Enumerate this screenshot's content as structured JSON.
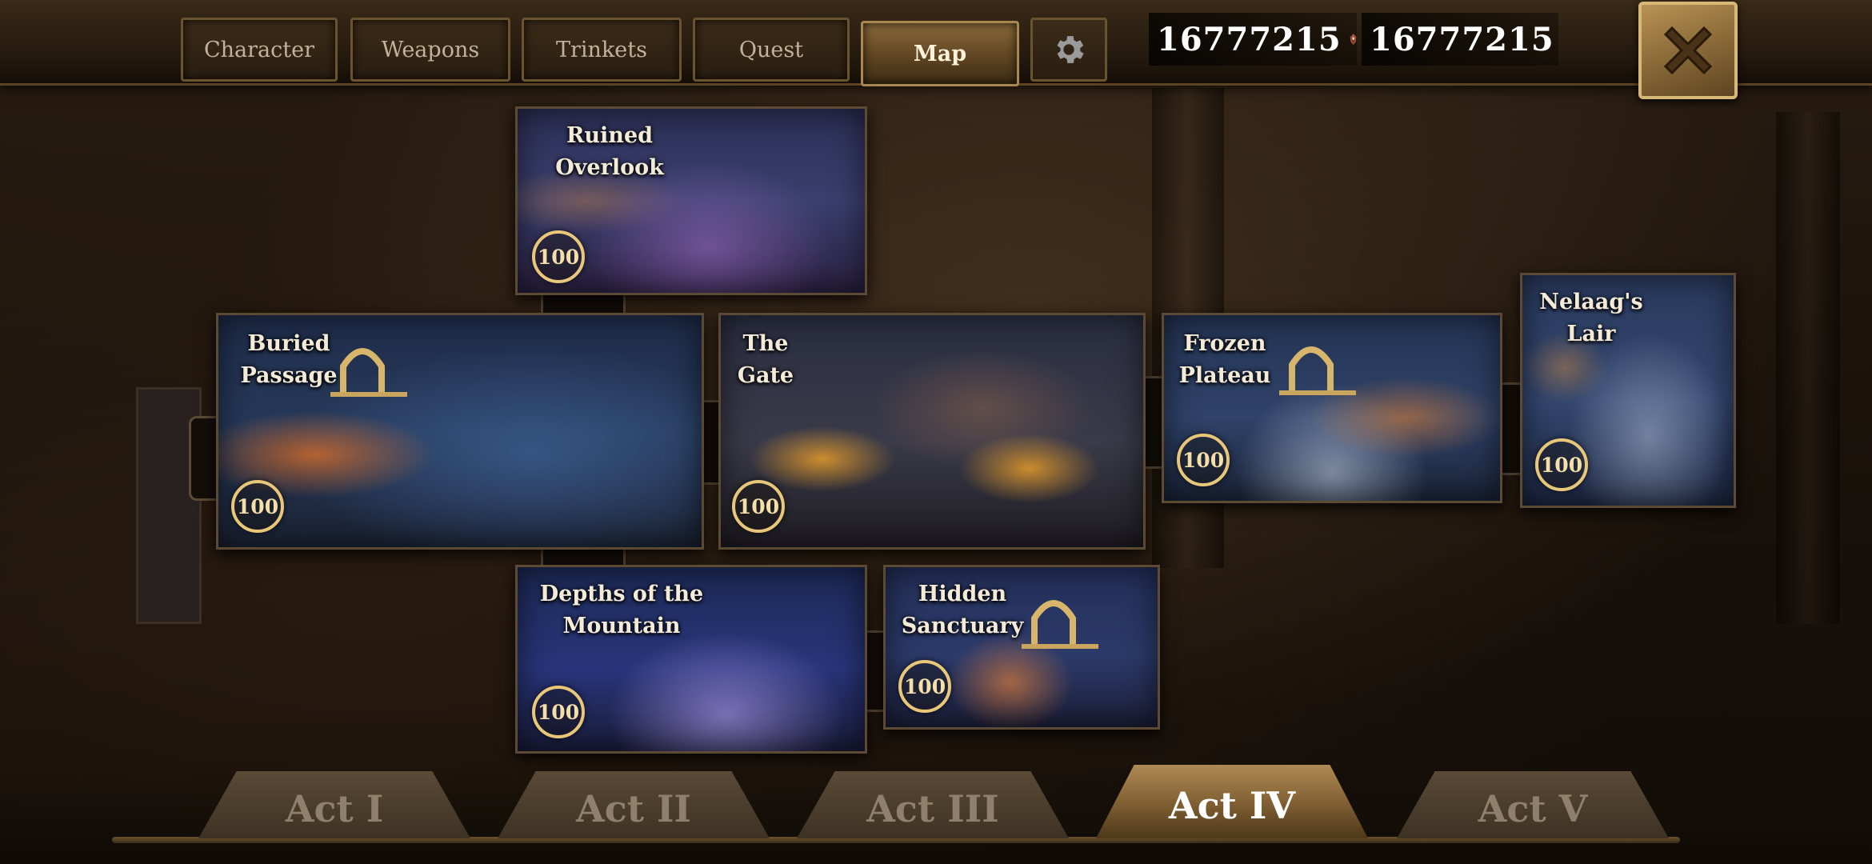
{
  "tabs": [
    {
      "label": "Character",
      "active": false
    },
    {
      "label": "Weapons",
      "active": false
    },
    {
      "label": "Trinkets",
      "active": false
    },
    {
      "label": "Quest",
      "active": false
    },
    {
      "label": "Map",
      "active": true
    }
  ],
  "currency": {
    "primary_amount": "16777215",
    "primary_icon": "red-crystal-icon",
    "secondary_amount": "16777215",
    "secondary_icon": "blue-crystal-icon"
  },
  "map": {
    "locations": [
      {
        "name": "Ruined\nOverlook",
        "completion": "100",
        "has_portal": false
      },
      {
        "name": "Buried\nPassage",
        "completion": "100",
        "has_portal": true
      },
      {
        "name": "The\nGate",
        "completion": "100",
        "has_portal": false
      },
      {
        "name": "Frozen\nPlateau",
        "completion": "100",
        "has_portal": true
      },
      {
        "name": "Nelaag's\nLair",
        "completion": "100",
        "has_portal": false
      },
      {
        "name": "Depths of the\nMountain",
        "completion": "100",
        "has_portal": false
      },
      {
        "name": "Hidden\nSanctuary",
        "completion": "100",
        "has_portal": true
      }
    ]
  },
  "acts": [
    {
      "label": "Act I",
      "active": false
    },
    {
      "label": "Act II",
      "active": false
    },
    {
      "label": "Act III",
      "active": false
    },
    {
      "label": "Act IV",
      "active": true
    },
    {
      "label": "Act V",
      "active": false
    }
  ],
  "colors": {
    "accent_gold": "#e9c77a",
    "active_tab": "#8a6a3a",
    "tile_frame": "#5c4a34"
  }
}
